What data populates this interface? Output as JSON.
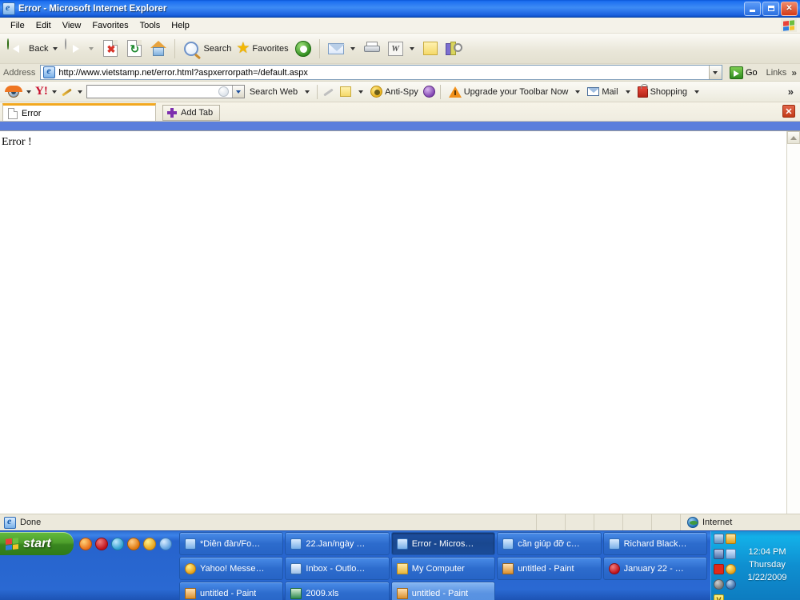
{
  "window": {
    "title": "Error - Microsoft Internet Explorer",
    "icon": "ie-document-icon",
    "minimize_label": "Minimize",
    "restore_label": "Restore",
    "close_label": "Close"
  },
  "menubar": {
    "items": [
      {
        "label": "File"
      },
      {
        "label": "Edit"
      },
      {
        "label": "View"
      },
      {
        "label": "Favorites"
      },
      {
        "label": "Tools"
      },
      {
        "label": "Help"
      }
    ],
    "logo": "windows-flag-icon"
  },
  "toolbar": {
    "back_label": "Back",
    "forward_label": "Forward",
    "stop_label": "Stop",
    "refresh_label": "Refresh",
    "home_label": "Home",
    "search_label": "Search",
    "favorites_label": "Favorites",
    "media_label": "Media",
    "mail_label": "Mail",
    "print_label": "Print",
    "edit_word_label": "Edit with Microsoft Office Word",
    "notes_label": "Notes",
    "research_label": "Research"
  },
  "address_bar": {
    "label": "Address",
    "url": "http://www.vietstamp.net/error.html?aspxerrorpath=/default.aspx",
    "go_label": "Go",
    "links_label": "Links",
    "more_chevron": "»"
  },
  "yahoo_toolbar": {
    "eye_icon": "yahoo-eye-icon",
    "logo": "Y!",
    "pencil_icon": "pencil-icon",
    "search_value": "",
    "search_placeholder": "",
    "search_web_label": "Search Web",
    "highlight_icon": "highlighter-icon",
    "popup_blocker_icon": "popup-blocker-icon",
    "anti_spy_label": "Anti-Spy",
    "purple_icon": "media-orb-icon",
    "upgrade_label": "Upgrade your Toolbar Now",
    "mail_label": "Mail",
    "shopping_label": "Shopping",
    "more_chevron": "»"
  },
  "tab_bar": {
    "tabs": [
      {
        "label": "Error",
        "active": true
      }
    ],
    "add_tab_label": "Add Tab",
    "close_tab_label": "✕"
  },
  "page": {
    "body_text": "Error !"
  },
  "status_bar": {
    "status": "Done",
    "zone": "Internet"
  },
  "taskbar": {
    "start_label": "start",
    "quick_launch": [
      {
        "name": "firefox-icon"
      },
      {
        "name": "opera-icon"
      },
      {
        "name": "browser-icon"
      },
      {
        "name": "media-player-icon"
      },
      {
        "name": "yahoo-messenger-icon"
      },
      {
        "name": "internet-explorer-icon"
      }
    ],
    "buttons": [
      {
        "label": "*Diễn đàn/Fo…",
        "icon": "ie",
        "state": "normal"
      },
      {
        "label": "22.Jan/ngày …",
        "icon": "ie",
        "state": "normal"
      },
      {
        "label": "Error - Micros…",
        "icon": "ie",
        "state": "active"
      },
      {
        "label": "cần giúp đỡ c…",
        "icon": "ie",
        "state": "normal"
      },
      {
        "label": "Richard Black…",
        "icon": "ie",
        "state": "normal"
      },
      {
        "label": "Yahoo! Messe…",
        "icon": "ym",
        "state": "normal"
      },
      {
        "label": "Inbox - Outlo…",
        "icon": "outlook",
        "state": "normal"
      },
      {
        "label": "My Computer",
        "icon": "folder",
        "state": "normal"
      },
      {
        "label": "untitled - Paint",
        "icon": "paint",
        "state": "normal"
      },
      {
        "label": "January 22 - …",
        "icon": "opera",
        "state": "normal"
      },
      {
        "label": "untitled - Paint",
        "icon": "paint",
        "state": "normal"
      },
      {
        "label": "2009.xls",
        "icon": "excel",
        "state": "normal"
      },
      {
        "label": "untitled - Paint",
        "icon": "paint",
        "state": "lite"
      }
    ],
    "tray": {
      "icons": [
        "network-icon",
        "mail-notify-icon",
        "display-icon",
        "messenger-icon",
        "antivirus-icon",
        "yahoo-messenger-tray-icon",
        "volume-icon",
        "updates-icon",
        "vietkey-icon"
      ],
      "vietkey_label": "V",
      "time": "12:04 PM",
      "day": "Thursday",
      "date": "1/22/2009"
    }
  },
  "colors": {
    "titlebar_blue": "#1d6ff0",
    "taskbar_blue": "#2663cd",
    "start_green": "#4ea02c",
    "tab_accent": "#f2a820",
    "close_red": "#c23a18"
  }
}
